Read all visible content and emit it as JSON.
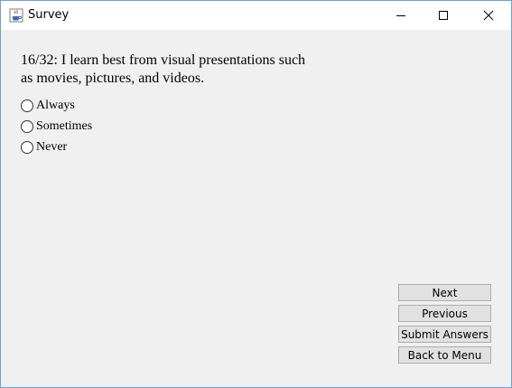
{
  "window": {
    "title": "Survey",
    "icon": "java-cup-icon",
    "controls": [
      "minimize-icon",
      "maximize-icon",
      "close-icon"
    ]
  },
  "question": {
    "text": "16/32: I learn best from visual presentations such as movies, pictures, and videos."
  },
  "options": [
    {
      "label": "Always",
      "selected": false
    },
    {
      "label": "Sometimes",
      "selected": false
    },
    {
      "label": "Never",
      "selected": false
    }
  ],
  "buttons": {
    "next": "Next",
    "previous": "Previous",
    "submit": "Submit Answers",
    "back": "Back to Menu"
  },
  "colors": {
    "window_border": "#6aa2d8",
    "panel_background": "#f0f0f0",
    "button_background": "#e1e1e1"
  }
}
